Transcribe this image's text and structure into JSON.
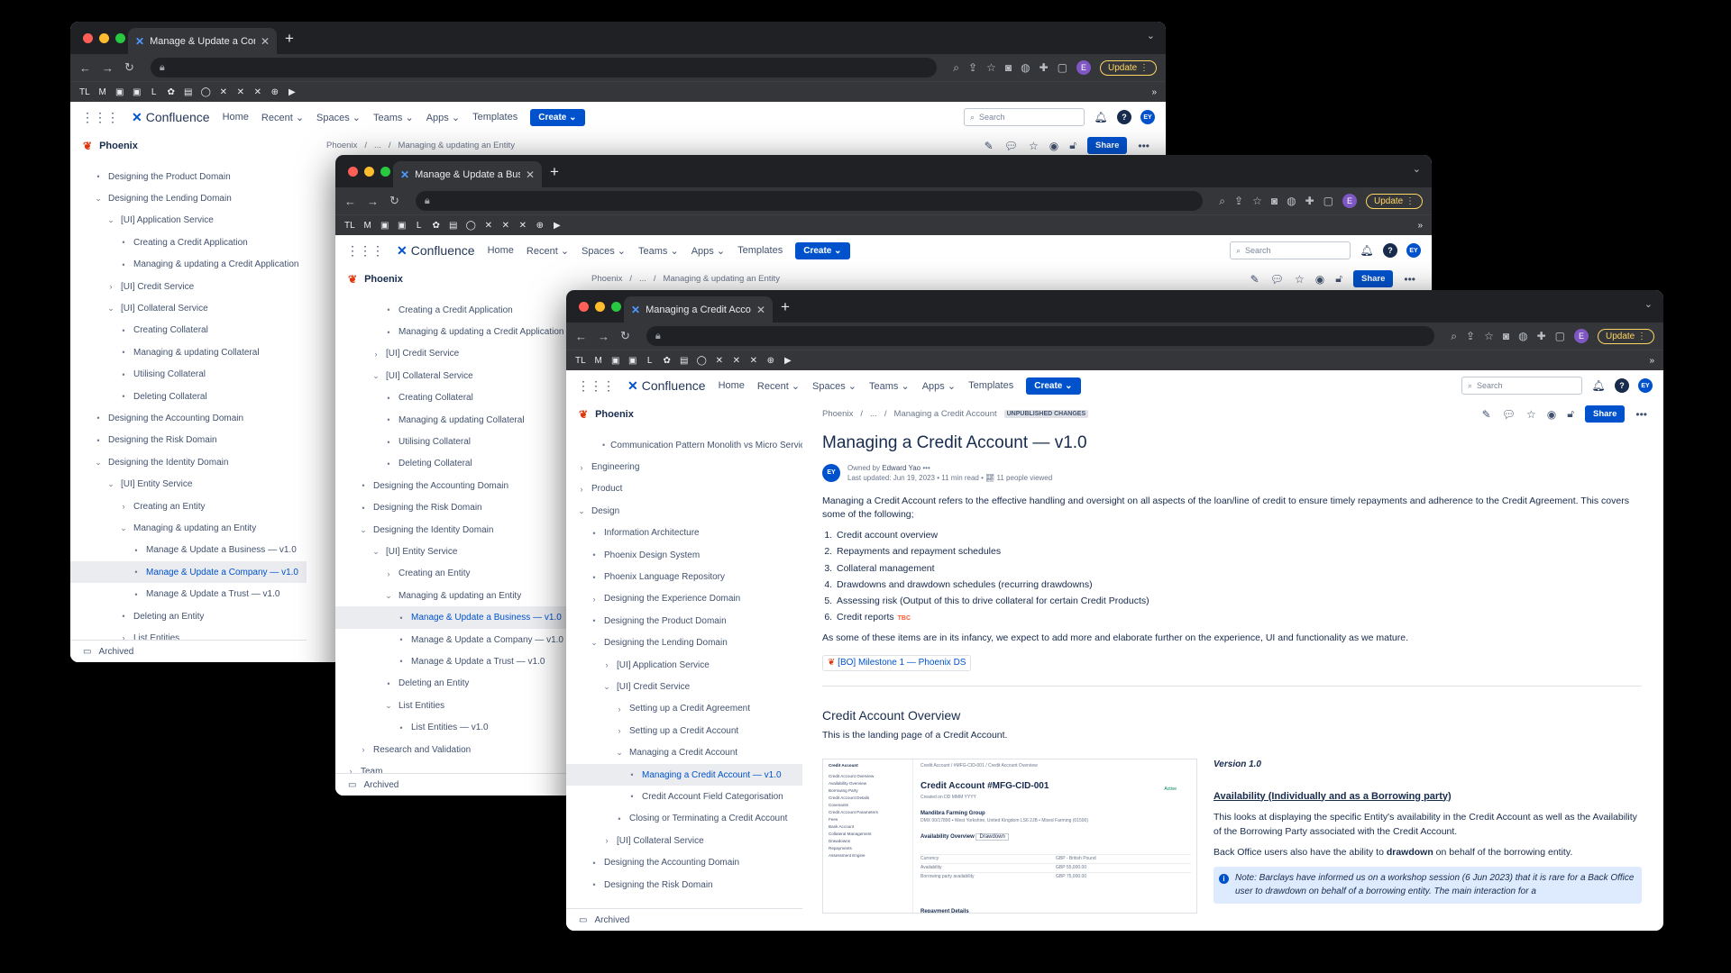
{
  "browser": {
    "address": "",
    "update_label": "Update",
    "profile_initial": "E",
    "bookmarks": [
      "TL",
      "M",
      "▣",
      "▣",
      "L",
      "✿",
      "▤",
      "◯",
      "✕",
      "✕",
      "✕",
      "⊕",
      "▶"
    ]
  },
  "confluence_nav": {
    "brand": "Confluence",
    "items": [
      "Home",
      "Recent",
      "Spaces",
      "Teams",
      "Apps",
      "Templates"
    ],
    "create_label": "Create",
    "search_placeholder": "Search",
    "avatar_initials": "EY"
  },
  "space_name": "Phoenix",
  "archived_label": "Archived",
  "share_label": "Share",
  "windows": [
    {
      "id": "w1",
      "tab_title": "Manage & Update a Company",
      "breadcrumb": [
        "Phoenix",
        "...",
        "Managing & updating an Entity"
      ],
      "tree": [
        {
          "label": "Designing the Product Domain",
          "level": 1,
          "bullet": "•"
        },
        {
          "label": "Designing the Lending Domain",
          "level": 1,
          "bullet": "⌄"
        },
        {
          "label": "[UI] Application Service",
          "level": 2,
          "bullet": "⌄"
        },
        {
          "label": "Creating a Credit Application",
          "level": 3,
          "bullet": "•"
        },
        {
          "label": "Managing & updating a Credit Application",
          "level": 3,
          "bullet": "•"
        },
        {
          "label": "[UI] Credit Service",
          "level": 2,
          "bullet": "›"
        },
        {
          "label": "[UI] Collateral Service",
          "level": 2,
          "bullet": "⌄"
        },
        {
          "label": "Creating Collateral",
          "level": 3,
          "bullet": "•"
        },
        {
          "label": "Managing & updating Collateral",
          "level": 3,
          "bullet": "•"
        },
        {
          "label": "Utilising Collateral",
          "level": 3,
          "bullet": "•"
        },
        {
          "label": "Deleting Collateral",
          "level": 3,
          "bullet": "•"
        },
        {
          "label": "Designing the Accounting Domain",
          "level": 1,
          "bullet": "•"
        },
        {
          "label": "Designing the Risk Domain",
          "level": 1,
          "bullet": "•"
        },
        {
          "label": "Designing the Identity Domain",
          "level": 1,
          "bullet": "⌄"
        },
        {
          "label": "[UI] Entity Service",
          "level": 2,
          "bullet": "⌄"
        },
        {
          "label": "Creating an Entity",
          "level": 3,
          "bullet": "›"
        },
        {
          "label": "Managing & updating an Entity",
          "level": 3,
          "bullet": "⌄"
        },
        {
          "label": "Manage & Update a Business — v1.0",
          "level": 4,
          "bullet": "•"
        },
        {
          "label": "Manage & Update a Company — v1.0",
          "level": 4,
          "bullet": "•",
          "selected": true
        },
        {
          "label": "Manage & Update a Trust — v1.0",
          "level": 4,
          "bullet": "•"
        },
        {
          "label": "Deleting an Entity",
          "level": 3,
          "bullet": "•"
        },
        {
          "label": "List Entities",
          "level": 3,
          "bullet": "›"
        }
      ]
    },
    {
      "id": "w2",
      "tab_title": "Manage & Update a Business",
      "breadcrumb": [
        "Phoenix",
        "...",
        "Managing & updating an Entity"
      ],
      "tree": [
        {
          "label": "Creating a Credit Application",
          "level": 3,
          "bullet": "•"
        },
        {
          "label": "Managing & updating a Credit Application",
          "level": 3,
          "bullet": "•"
        },
        {
          "label": "[UI] Credit Service",
          "level": 2,
          "bullet": "›"
        },
        {
          "label": "[UI] Collateral Service",
          "level": 2,
          "bullet": "⌄"
        },
        {
          "label": "Creating Collateral",
          "level": 3,
          "bullet": "•"
        },
        {
          "label": "Managing & updating Collateral",
          "level": 3,
          "bullet": "•"
        },
        {
          "label": "Utilising Collateral",
          "level": 3,
          "bullet": "•"
        },
        {
          "label": "Deleting Collateral",
          "level": 3,
          "bullet": "•"
        },
        {
          "label": "Designing the Accounting Domain",
          "level": 1,
          "bullet": "•"
        },
        {
          "label": "Designing the Risk Domain",
          "level": 1,
          "bullet": "•"
        },
        {
          "label": "Designing the Identity Domain",
          "level": 1,
          "bullet": "⌄"
        },
        {
          "label": "[UI] Entity Service",
          "level": 2,
          "bullet": "⌄"
        },
        {
          "label": "Creating an Entity",
          "level": 3,
          "bullet": "›"
        },
        {
          "label": "Managing & updating an Entity",
          "level": 3,
          "bullet": "⌄"
        },
        {
          "label": "Manage & Update a Business — v1.0",
          "level": 4,
          "bullet": "•",
          "selected": true
        },
        {
          "label": "Manage & Update a Company — v1.0",
          "level": 4,
          "bullet": "•"
        },
        {
          "label": "Manage & Update a Trust — v1.0",
          "level": 4,
          "bullet": "•"
        },
        {
          "label": "Deleting an Entity",
          "level": 3,
          "bullet": "•"
        },
        {
          "label": "List Entities",
          "level": 3,
          "bullet": "⌄"
        },
        {
          "label": "List Entities — v1.0",
          "level": 4,
          "bullet": "•"
        },
        {
          "label": "Research and Validation",
          "level": 1,
          "bullet": "›"
        },
        {
          "label": "Team",
          "level": 0,
          "bullet": "›"
        }
      ]
    },
    {
      "id": "w3",
      "tab_title": "Managing a Credit Account — …",
      "breadcrumb": [
        "Phoenix",
        "...",
        "Managing a Credit Account"
      ],
      "unpublished": "UNPUBLISHED CHANGES",
      "tree": [
        {
          "label": "Communication Pattern Monolith vs Micro Service",
          "level": 2,
          "bullet": "•"
        },
        {
          "label": "Engineering",
          "level": 0,
          "bullet": "›"
        },
        {
          "label": "Product",
          "level": 0,
          "bullet": "›"
        },
        {
          "label": "Design",
          "level": 0,
          "bullet": "⌄"
        },
        {
          "label": "Information Architecture",
          "level": 1,
          "bullet": "•"
        },
        {
          "label": "Phoenix Design System",
          "level": 1,
          "bullet": "•"
        },
        {
          "label": "Phoenix Language Repository",
          "level": 1,
          "bullet": "•"
        },
        {
          "label": "Designing the Experience Domain",
          "level": 1,
          "bullet": "›"
        },
        {
          "label": "Designing the Product Domain",
          "level": 1,
          "bullet": "•"
        },
        {
          "label": "Designing the Lending Domain",
          "level": 1,
          "bullet": "⌄"
        },
        {
          "label": "[UI] Application Service",
          "level": 2,
          "bullet": "›"
        },
        {
          "label": "[UI] Credit Service",
          "level": 2,
          "bullet": "⌄"
        },
        {
          "label": "Setting up a Credit Agreement",
          "level": 3,
          "bullet": "›"
        },
        {
          "label": "Setting up a Credit Account",
          "level": 3,
          "bullet": "›"
        },
        {
          "label": "Managing a Credit Account",
          "level": 3,
          "bullet": "⌄"
        },
        {
          "label": "Managing a Credit Account — v1.0",
          "level": 4,
          "bullet": "•",
          "selected": true
        },
        {
          "label": "Credit Account Field Categorisation",
          "level": 4,
          "bullet": "•"
        },
        {
          "label": "Closing or Terminating a Credit Account",
          "level": 3,
          "bullet": "•"
        },
        {
          "label": "[UI] Collateral Service",
          "level": 2,
          "bullet": "›"
        },
        {
          "label": "Designing the Accounting Domain",
          "level": 1,
          "bullet": "•"
        },
        {
          "label": "Designing the Risk Domain",
          "level": 1,
          "bullet": "•"
        }
      ],
      "article": {
        "title": "Managing a Credit Account — v1.0",
        "owned_by_prefix": "Owned by",
        "owner": "Edward Yao",
        "updated": "Last updated: Jun 19, 2023",
        "read_time": "11 min read",
        "viewed": "11 people viewed",
        "intro": "Managing a Credit Account refers to the effective handling and oversight on all aspects of the loan/line of credit to ensure timely repayments and adherence to the Credit Agreement. This covers some of the following;",
        "list": [
          "Credit account overview",
          "Repayments and repayment schedules",
          "Collateral management",
          "Drawdowns and drawdown schedules (recurring drawdowns)",
          "Assessing risk (Output of this to drive collateral for certain Credit Products)",
          "Credit reports"
        ],
        "tbc": "TBC",
        "outro": "As some of these items are in its infancy, we expect to add more and elaborate further on the experience, UI and functionality as we mature.",
        "milestone": "[BO] Milestone 1 — Phoenix DS",
        "h2": "Credit Account Overview",
        "h2_sub": "This is the landing page of a Credit Account.",
        "version": "Version 1.0",
        "availability_heading": "Availability (Individually and as a Borrowing party)",
        "availability_text": "This looks at displaying the specific Entity's availability in the Credit Account as well as the Availability of the Borrowing Party associated with the Credit Account.",
        "drawdown_prefix": "Back Office users also have the ability to ",
        "drawdown_bold": "drawdown",
        "drawdown_suffix": " on behalf of the borrowing entity.",
        "note": "Note: Barclays have informed us on a workshop session (6 Jun 2023) that it is rare for a Back Office user to drawdown on behalf of a borrowing entity. The main interaction for a",
        "embedded": {
          "side_title": "Credit Account",
          "side_items": [
            "Credit Account Overview",
            "Availability Overview",
            "Borrowing Party",
            "Credit Account Details",
            "Covenants",
            "Credit Account Parameters",
            "Fees",
            "Bank Account",
            "Collateral Management",
            "Drawdowns",
            "Repayments",
            "Assessment Engine"
          ],
          "crumb": "Credit Account / #MFG-CID-001 / Credit Account Overview",
          "title": "Credit Account #MFG-CID-001",
          "created": "Created on DD MMM YYYY",
          "status": "Active",
          "entity": "Mandibra Farming Group",
          "entity_sub": "DMX 00/17890 • West Yorkshire, United Kingdom LS6 2JB • Mixed Farming (01500)",
          "availability_label": "Availability Overview",
          "drawdown_label": "Drawdown",
          "rows": [
            [
              "Currency",
              "GBP - British Pound"
            ],
            [
              "Availability",
              "GBP 55,000.00"
            ],
            [
              "Borrowing party availability",
              "GBP 75,000.00"
            ]
          ],
          "repayments": "Repayment Details"
        }
      }
    }
  ]
}
